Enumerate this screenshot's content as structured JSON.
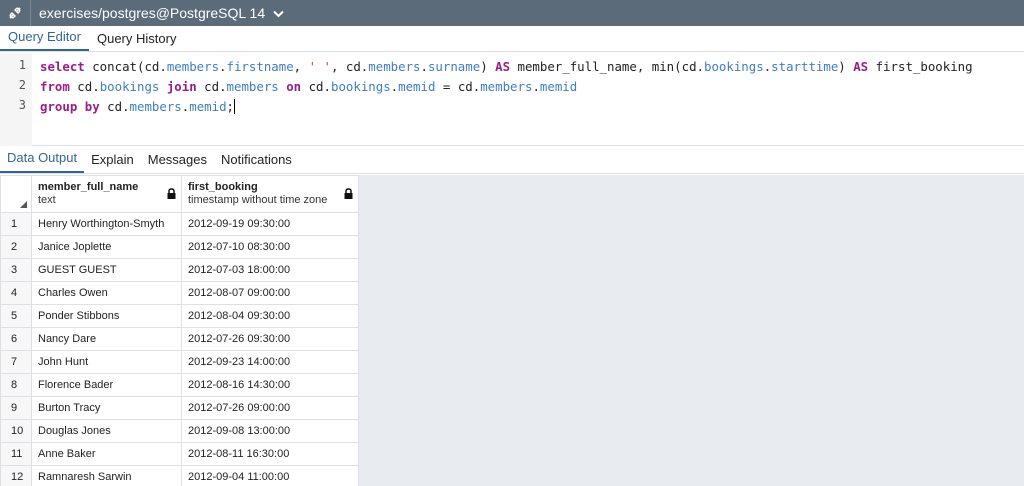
{
  "titlebar": {
    "connection": "exercises/postgres@PostgreSQL 14",
    "icons": {
      "connect": "plug-icon",
      "dropdown": "chevron-down-icon"
    }
  },
  "editor_tabs": [
    {
      "label": "Query Editor",
      "active": true
    },
    {
      "label": "Query History",
      "active": false
    }
  ],
  "editor": {
    "line_numbers": [
      "1",
      "2",
      "3"
    ],
    "lines": [
      "select concat(cd.members.firstname, ' ', cd.members.surname) AS member_full_name, min(cd.bookings.starttime) AS first_booking",
      "from cd.bookings join cd.members on cd.bookings.memid = cd.members.memid",
      "group by cd.members.memid;"
    ]
  },
  "output_tabs": [
    {
      "label": "Data Output",
      "active": true
    },
    {
      "label": "Explain",
      "active": false
    },
    {
      "label": "Messages",
      "active": false
    },
    {
      "label": "Notifications",
      "active": false
    }
  ],
  "grid": {
    "columns": [
      {
        "name": "member_full_name",
        "type": "text",
        "icon": "lock-icon"
      },
      {
        "name": "first_booking",
        "type": "timestamp without time zone",
        "icon": "lock-icon"
      }
    ],
    "rows": [
      {
        "n": "1",
        "name": "Henry Worthington-Smyth",
        "first": "2012-09-19 09:30:00"
      },
      {
        "n": "2",
        "name": "Janice Joplette",
        "first": "2012-07-10 08:30:00"
      },
      {
        "n": "3",
        "name": "GUEST GUEST",
        "first": "2012-07-03 18:00:00"
      },
      {
        "n": "4",
        "name": "Charles Owen",
        "first": "2012-08-07 09:00:00"
      },
      {
        "n": "5",
        "name": "Ponder Stibbons",
        "first": "2012-08-04 09:30:00"
      },
      {
        "n": "6",
        "name": "Nancy Dare",
        "first": "2012-07-26 09:30:00"
      },
      {
        "n": "7",
        "name": "John Hunt",
        "first": "2012-09-23 14:00:00"
      },
      {
        "n": "8",
        "name": "Florence Bader",
        "first": "2012-08-16 14:30:00"
      },
      {
        "n": "9",
        "name": "Burton Tracy",
        "first": "2012-07-26 09:00:00"
      },
      {
        "n": "10",
        "name": "Douglas Jones",
        "first": "2012-09-08 13:00:00"
      },
      {
        "n": "11",
        "name": "Anne Baker",
        "first": "2012-08-11 16:30:00"
      },
      {
        "n": "12",
        "name": "Ramnaresh Sarwin",
        "first": "2012-09-04 11:00:00"
      }
    ]
  },
  "colors": {
    "titlebar": "#5c6b7a",
    "accent": "#326690",
    "keyword": "#9a1d8a",
    "reference": "#3f7ec2"
  }
}
